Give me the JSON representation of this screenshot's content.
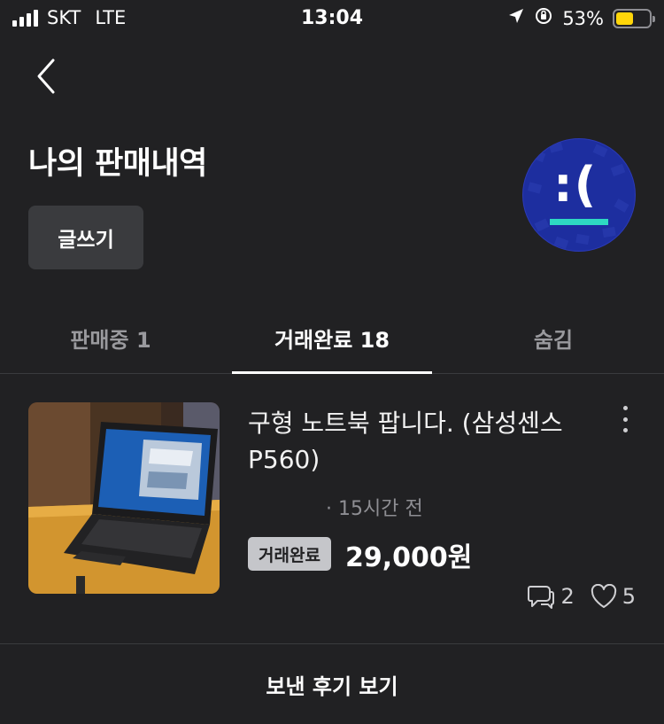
{
  "status_bar": {
    "carrier": "SKT",
    "network": "LTE",
    "time": "13:04",
    "battery_percent": "53%",
    "battery_level": 0.53,
    "battery_color": "#ffd60a"
  },
  "header": {
    "title": "나의 판매내역",
    "write_button": "글쓰기",
    "back_icon": "chevron-left-icon"
  },
  "tabs": [
    {
      "label": "판매중 1",
      "active": false
    },
    {
      "label": "거래완료 18",
      "active": true
    },
    {
      "label": "숨김",
      "active": false
    }
  ],
  "listing": {
    "title": "구형 노트북 팝니다. (삼성센스 P560)",
    "time": "· 15시간 전",
    "status": "거래완료",
    "price": "29,000원",
    "chat_count": "2",
    "like_count": "5"
  },
  "footer": {
    "label": "보낸 후기 보기"
  },
  "colors": {
    "background": "#212123",
    "badge": "#c5c6ca",
    "avatar_bg": "#1d2e9f",
    "avatar_accent": "#2ed9c2"
  }
}
